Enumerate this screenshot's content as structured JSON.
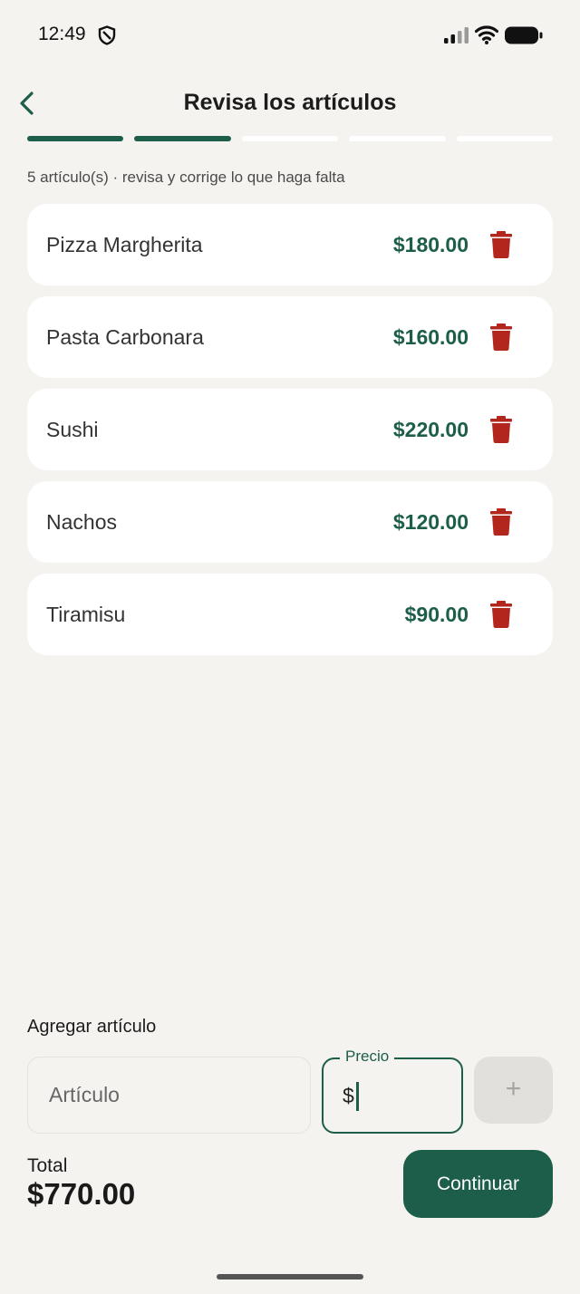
{
  "status_bar": {
    "time": "12:49",
    "icons": [
      "shield-icon",
      "signal-icon",
      "wifi-icon",
      "battery-icon"
    ]
  },
  "header": {
    "title": "Revisa los artículos",
    "back_icon": "chevron-left-icon"
  },
  "progress": {
    "total_steps": 5,
    "completed_steps": 2
  },
  "subtitle": "5 artículo(s) · revisa y corrige lo que haga falta",
  "items": [
    {
      "name": "Pizza Margherita",
      "price": "$180.00"
    },
    {
      "name": "Pasta Carbonara",
      "price": "$160.00"
    },
    {
      "name": "Sushi",
      "price": "$220.00"
    },
    {
      "name": "Nachos",
      "price": "$120.00"
    },
    {
      "name": "Tiramisu",
      "price": "$90.00"
    }
  ],
  "add_item": {
    "label": "Agregar artículo",
    "article_placeholder": "Artículo",
    "price_label": "Precio",
    "price_prefix": "$",
    "add_button": "+"
  },
  "summary": {
    "total_label": "Total",
    "total_value": "$770.00",
    "continue_label": "Continuar"
  },
  "colors": {
    "accent": "#1c5e4a",
    "delete": "#b3261e",
    "background": "#f5f3ef"
  }
}
